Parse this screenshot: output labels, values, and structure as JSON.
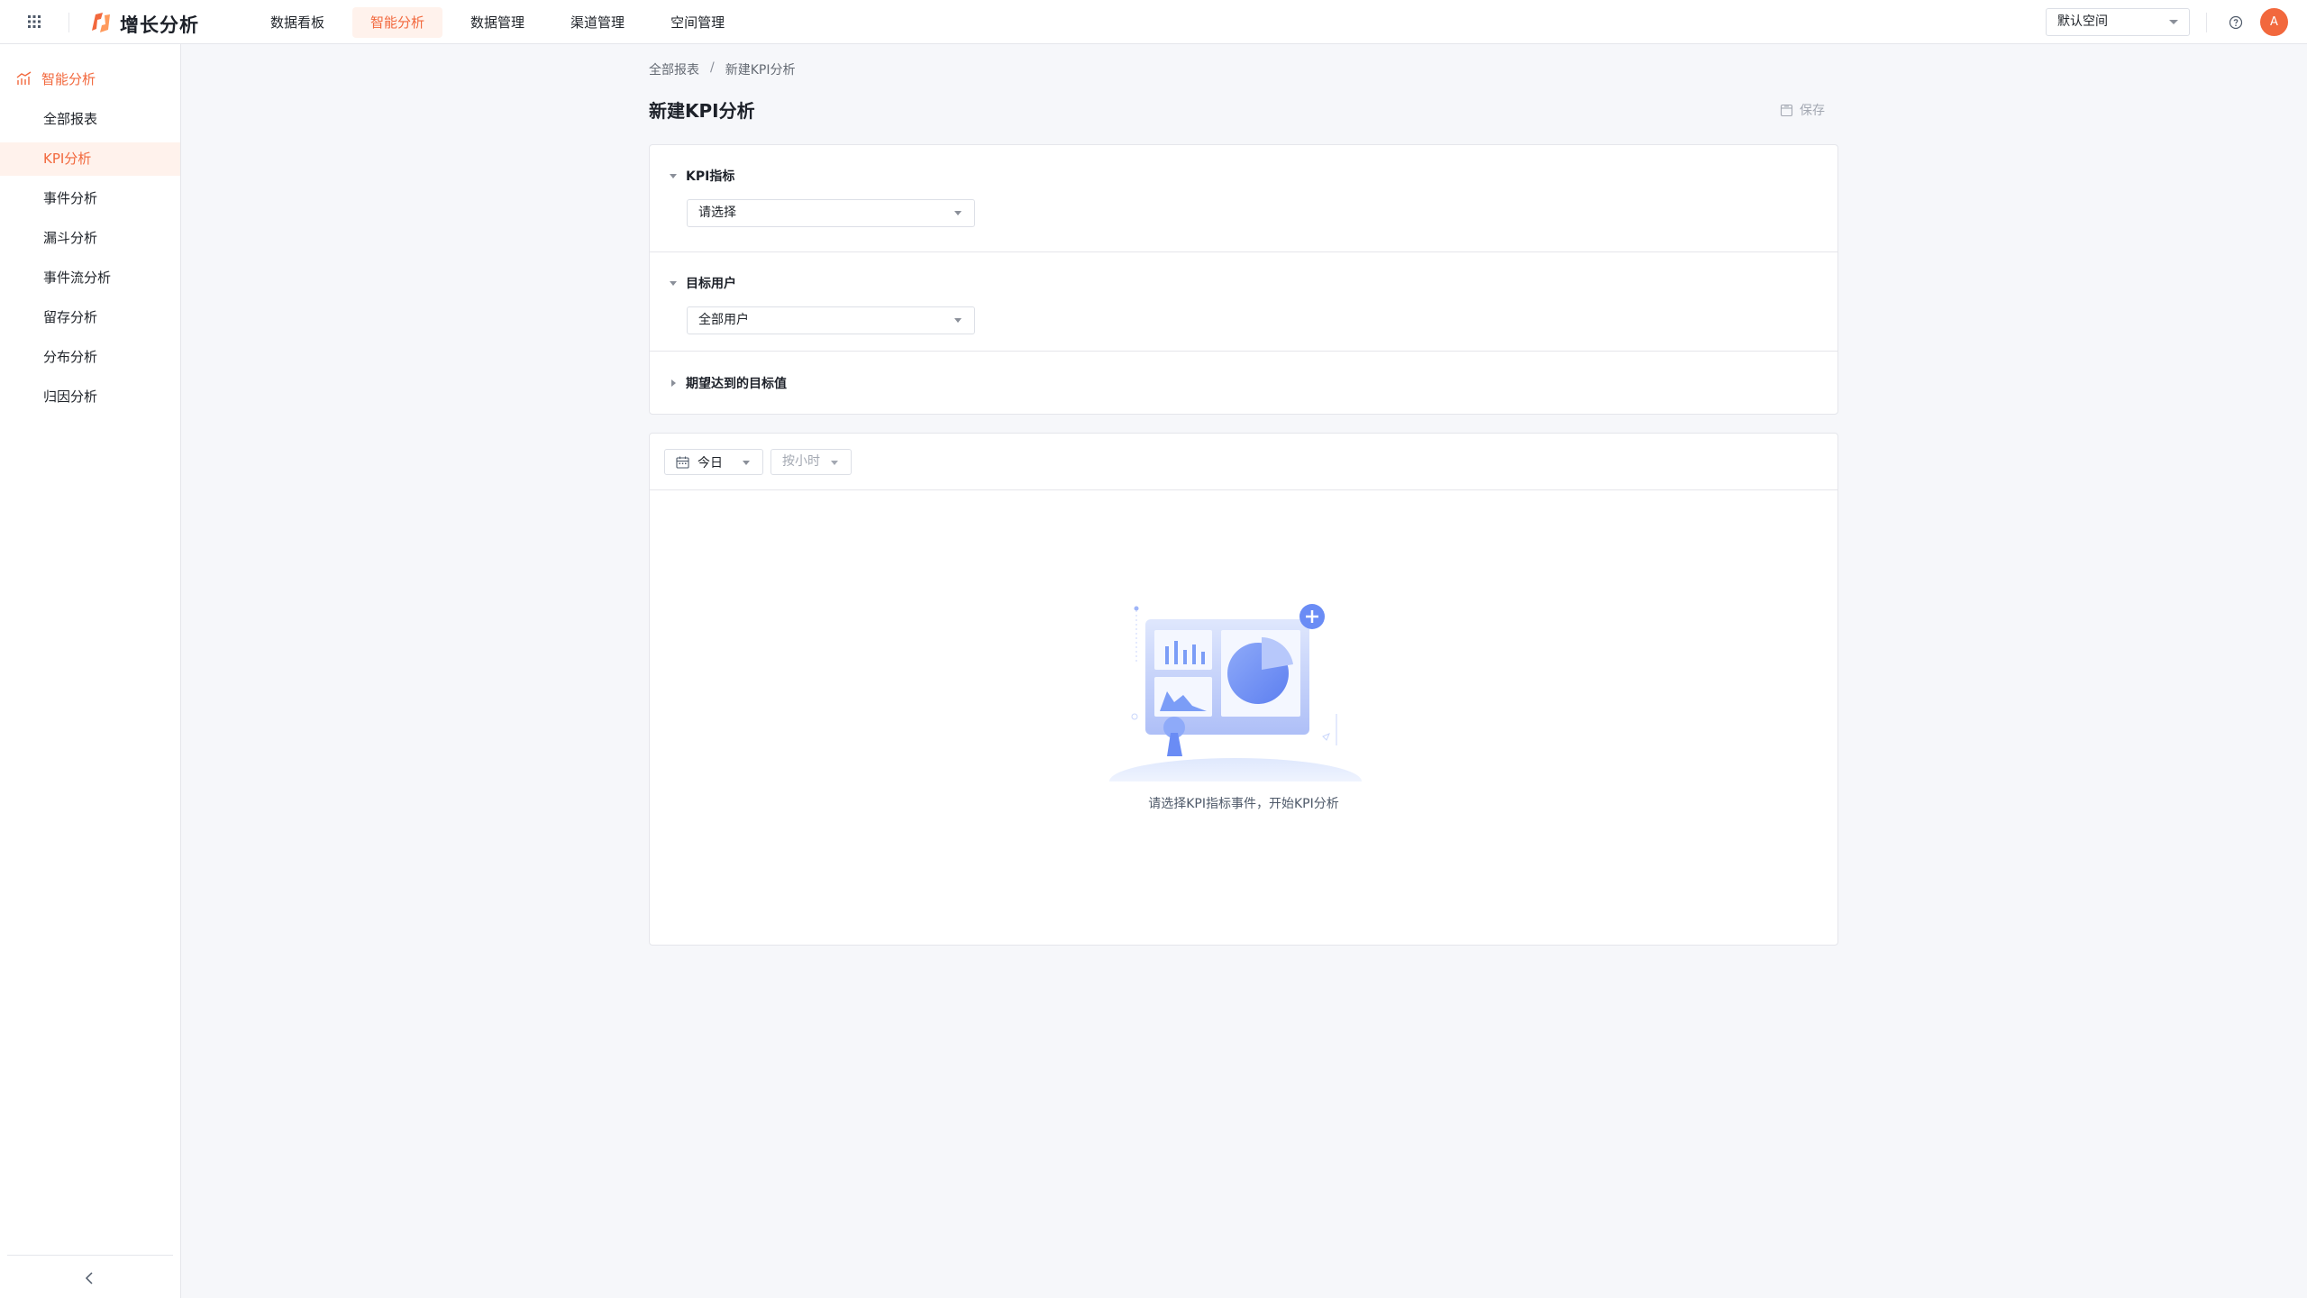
{
  "app": {
    "name": "增长分析"
  },
  "topnav": {
    "items": [
      {
        "label": "数据看板",
        "active": false
      },
      {
        "label": "智能分析",
        "active": true
      },
      {
        "label": "数据管理",
        "active": false
      },
      {
        "label": "渠道管理",
        "active": false
      },
      {
        "label": "空间管理",
        "active": false
      }
    ],
    "space_select": "默认空间",
    "avatar_letter": "A"
  },
  "sidebar": {
    "group_label": "智能分析",
    "items": [
      {
        "label": "全部报表",
        "active": false
      },
      {
        "label": "KPI分析",
        "active": true
      },
      {
        "label": "事件分析",
        "active": false
      },
      {
        "label": "漏斗分析",
        "active": false
      },
      {
        "label": "事件流分析",
        "active": false
      },
      {
        "label": "留存分析",
        "active": false
      },
      {
        "label": "分布分析",
        "active": false
      },
      {
        "label": "归因分析",
        "active": false
      }
    ]
  },
  "breadcrumb": {
    "parent": "全部报表",
    "separator": "/",
    "current": "新建KPI分析"
  },
  "page": {
    "title": "新建KPI分析",
    "save_label": "保存"
  },
  "config": {
    "kpi": {
      "label": "KPI指标",
      "placeholder": "请选择"
    },
    "target_users": {
      "label": "目标用户",
      "value": "全部用户"
    },
    "goal": {
      "label": "期望达到的目标值"
    }
  },
  "result": {
    "date_range": "今日",
    "granularity": "按小时",
    "empty_text": "请选择KPI指标事件，开始KPI分析"
  },
  "colors": {
    "accent": "#f2683d",
    "accent_bg": "#fff2ec",
    "illustration_blue": "#7b9df7"
  }
}
